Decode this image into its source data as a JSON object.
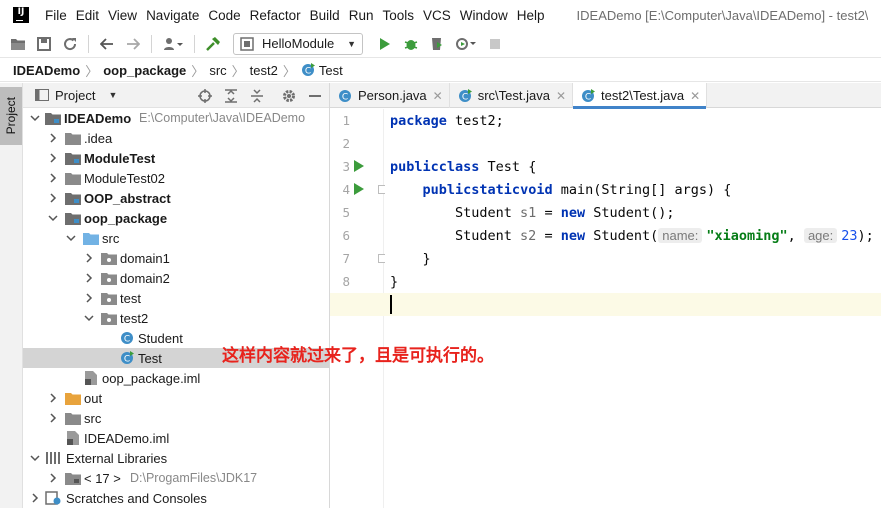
{
  "menubar": {
    "logo_text": "IJ",
    "items": [
      "File",
      "Edit",
      "View",
      "Navigate",
      "Code",
      "Refactor",
      "Build",
      "Run",
      "Tools",
      "VCS",
      "Window",
      "Help"
    ],
    "window_title": "IDEADemo [E:\\Computer\\Java\\IDEADemo] - test2\\"
  },
  "toolbar": {
    "icons": [
      "folder-open-icon",
      "save-icon",
      "sync-icon",
      "back-arrow-icon",
      "forward-arrow-icon",
      "user-icon",
      "build-hammer-icon",
      "run-icon",
      "debug-bug-icon",
      "coverage-icon",
      "profile-icon",
      "stop-icon"
    ],
    "run_config": "HelloModule"
  },
  "breadcrumb": [
    "IDEADemo",
    "oop_package",
    "src",
    "test2",
    "Test"
  ],
  "left_stripe": {
    "project_tab": "Project"
  },
  "project_panel": {
    "title": "Project",
    "tree": [
      {
        "label": "IDEADemo",
        "hint": "E:\\Computer\\Java\\IDEADemo",
        "bold": true,
        "expanded": true
      },
      {
        "label": ".idea"
      },
      {
        "label": "ModuleTest",
        "bold": true
      },
      {
        "label": "ModuleTest02"
      },
      {
        "label": "OOP_abstract",
        "bold": true
      },
      {
        "label": "oop_package",
        "bold": true,
        "expanded": true
      },
      {
        "label": "src",
        "expanded": true
      },
      {
        "label": "domain1"
      },
      {
        "label": "domain2"
      },
      {
        "label": "test"
      },
      {
        "label": "test2",
        "expanded": true
      },
      {
        "label": "Student"
      },
      {
        "label": "Test",
        "selected": true
      },
      {
        "label": "oop_package.iml"
      },
      {
        "label": "out"
      },
      {
        "label": "src"
      },
      {
        "label": "IDEADemo.iml"
      },
      {
        "label": "External Libraries"
      },
      {
        "label": "< 17 >",
        "hint": "D:\\ProgamFiles\\JDK17"
      },
      {
        "label": "Scratches and Consoles"
      }
    ]
  },
  "editor": {
    "tabs": [
      {
        "label": "Person.java",
        "active": false
      },
      {
        "label": "src\\Test.java",
        "active": false
      },
      {
        "label": "test2\\Test.java",
        "active": true
      }
    ],
    "line_numbers": [
      "1",
      "2",
      "3",
      "4",
      "5",
      "6",
      "7",
      "8",
      "9"
    ],
    "code": {
      "l1_kw": "package",
      "l1_rest": " test2;",
      "l3_kw1": "public",
      "l3_kw2": "class",
      "l3_rest": " Test {",
      "l4_indent": "    ",
      "l4_kw1": "public",
      "l4_kw2": "static",
      "l4_kw3": "void",
      "l4_rest": " main(String[] args) {",
      "l5_a": "        Student ",
      "l5_var": "s1",
      "l5_b": " = ",
      "l5_kw": "new",
      "l5_c": " Student();",
      "l6_a": "        Student ",
      "l6_var": "s2",
      "l6_b": " = ",
      "l6_kw": "new",
      "l6_c": " Student(",
      "l6_hint1": "name:",
      "l6_str": "\"xiaoming\"",
      "l6_comma": ", ",
      "l6_hint2": "age:",
      "l6_num": "23",
      "l6_end": ");",
      "l7": "    }",
      "l8": "}"
    }
  },
  "annotation": "这样内容就过来了，且是可执行的。"
}
